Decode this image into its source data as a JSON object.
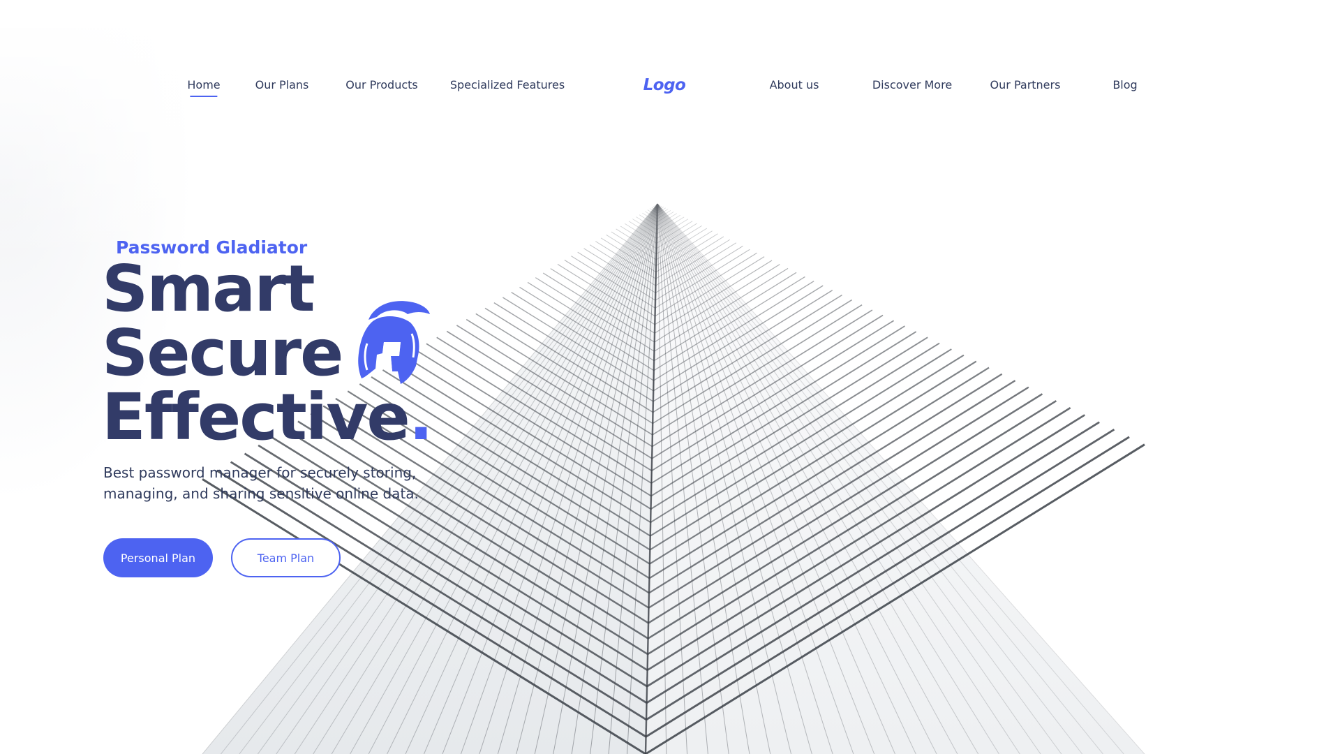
{
  "nav": {
    "items": [
      {
        "label": "Home",
        "active": true
      },
      {
        "label": "Our Plans"
      },
      {
        "label": "Our Products"
      },
      {
        "label": "Specialized Features"
      },
      {
        "label": "About us"
      },
      {
        "label": "Discover More"
      },
      {
        "label": "Our Partners"
      },
      {
        "label": "Blog"
      }
    ],
    "logo": "Logo"
  },
  "hero": {
    "eyebrow": "Password Gladiator",
    "headline_lines": [
      "Smart",
      "Secure",
      "Effective"
    ],
    "headline_end_mark": ".",
    "subtitle": "Best password manager for securely storing, managing, and sharing sensitive online data.",
    "primary_button": "Personal Plan",
    "secondary_button": "Team Plan",
    "icon": "gladiator-helmet-icon"
  },
  "colors": {
    "accent": "#4d63f1",
    "heading": "#323b68",
    "text": "#2f3a5c",
    "background": "#ffffff"
  }
}
